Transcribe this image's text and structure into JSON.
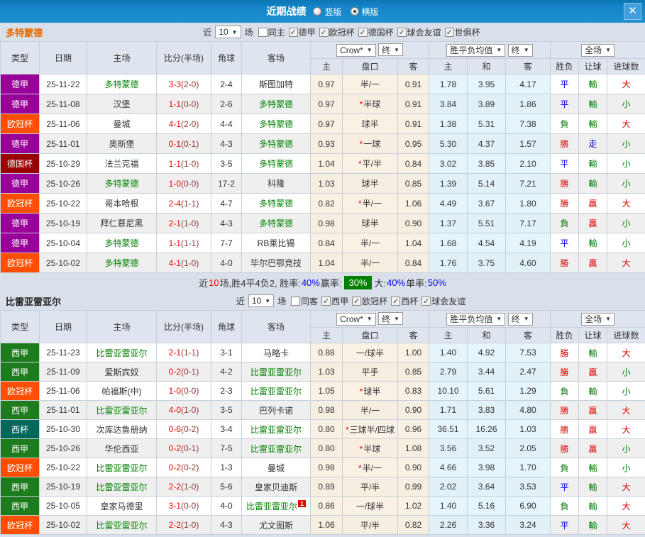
{
  "header": {
    "title": "近期战绩",
    "radios": [
      {
        "label": "竖版",
        "selected": false
      },
      {
        "label": "横版",
        "selected": true
      }
    ],
    "close_label": "✕"
  },
  "table_header": {
    "cols": [
      "类型",
      "日期",
      "主场",
      "比分(半场)",
      "角球",
      "客场"
    ],
    "odds_dropdown": "Crow*",
    "final_dropdown": "终",
    "mean_dropdown": "胜平负均值",
    "full_dropdown": "全场",
    "sub": [
      "主",
      "盘口",
      "客",
      "主",
      "和",
      "客",
      "胜负",
      "让球",
      "进球数"
    ]
  },
  "league_colors": {
    "德甲": "#990099",
    "欧冠杯": "#ff4e00",
    "德国杯": "#990000",
    "西甲": "#1e7c1e",
    "西杯": "#00695c"
  },
  "sections": [
    {
      "team": "多特蒙德",
      "team_color": "#e56a00",
      "filters": {
        "near": "近",
        "count": "10",
        "games": "场",
        "checkboxes": [
          {
            "label": "同主",
            "checked": false
          },
          {
            "label": "德甲",
            "checked": true
          },
          {
            "label": "欧冠杯",
            "checked": true
          },
          {
            "label": "德国杯",
            "checked": true
          },
          {
            "label": "球会友谊",
            "checked": true
          },
          {
            "label": "世俱杯",
            "checked": true
          }
        ]
      },
      "rows": [
        {
          "league": "德甲",
          "date": "25-11-22",
          "home": "多特蒙德",
          "ft": "3-3",
          "ht": "(2-0)",
          "corner": "2-4",
          "away": "斯图加特",
          "odds": [
            "0.97",
            "半/一",
            "0.91"
          ],
          "means": [
            "1.78",
            "3.95",
            "4.17"
          ],
          "results": [
            "平",
            "輸",
            "大"
          ]
        },
        {
          "league": "德甲",
          "date": "25-11-08",
          "home": "汉堡",
          "ft": "1-1",
          "ht": "(0-0)",
          "corner": "2-6",
          "away": "多特蒙德",
          "odds": [
            "0.97",
            "*半球",
            "0.91"
          ],
          "means": [
            "3.84",
            "3.89",
            "1.86"
          ],
          "results": [
            "平",
            "輸",
            "小"
          ]
        },
        {
          "league": "欧冠杯",
          "date": "25-11-06",
          "home": "曼城",
          "ft": "4-1",
          "ht": "(2-0)",
          "corner": "4-4",
          "away": "多特蒙德",
          "odds": [
            "0.97",
            "球半",
            "0.91"
          ],
          "means": [
            "1.38",
            "5.31",
            "7.38"
          ],
          "results": [
            "負",
            "輸",
            "大"
          ]
        },
        {
          "league": "德甲",
          "date": "25-11-01",
          "home": "奥斯堡",
          "ft": "0-1",
          "ht": "(0-1)",
          "corner": "4-3",
          "away": "多特蒙德",
          "odds": [
            "0.93",
            "*一球",
            "0.95"
          ],
          "means": [
            "5.30",
            "4.37",
            "1.57"
          ],
          "results": [
            "勝",
            "走",
            "小"
          ]
        },
        {
          "league": "德国杯",
          "date": "25-10-29",
          "home": "法兰克福",
          "ft": "1-1",
          "ht": "(1-0)",
          "corner": "3-5",
          "away": "多特蒙德",
          "odds": [
            "1.04",
            "*平/半",
            "0.84"
          ],
          "means": [
            "3.02",
            "3.85",
            "2.10"
          ],
          "results": [
            "平",
            "輸",
            "小"
          ]
        },
        {
          "league": "德甲",
          "date": "25-10-26",
          "home": "多特蒙德",
          "ft": "1-0",
          "ht": "(0-0)",
          "corner": "17-2",
          "away": "科隆",
          "odds": [
            "1.03",
            "球半",
            "0.85"
          ],
          "means": [
            "1.39",
            "5.14",
            "7.21"
          ],
          "results": [
            "勝",
            "輸",
            "小"
          ]
        },
        {
          "league": "欧冠杯",
          "date": "25-10-22",
          "home": "哥本哈根",
          "ft": "2-4",
          "ht": "(1-1)",
          "corner": "4-7",
          "away": "多特蒙德",
          "odds": [
            "0.82",
            "*半/一",
            "1.06"
          ],
          "means": [
            "4.49",
            "3.67",
            "1.80"
          ],
          "results": [
            "勝",
            "贏",
            "大"
          ]
        },
        {
          "league": "德甲",
          "date": "25-10-19",
          "home": "拜仁慕尼黑",
          "ft": "2-1",
          "ht": "(1-0)",
          "corner": "4-3",
          "away": "多特蒙德",
          "odds": [
            "0.98",
            "球半",
            "0.90"
          ],
          "means": [
            "1.37",
            "5.51",
            "7.17"
          ],
          "results": [
            "負",
            "贏",
            "小"
          ]
        },
        {
          "league": "德甲",
          "date": "25-10-04",
          "home": "多特蒙德",
          "ft": "1-1",
          "ht": "(1-1)",
          "corner": "7-7",
          "away": "RB莱比锡",
          "odds": [
            "0.84",
            "半/一",
            "1.04"
          ],
          "means": [
            "1.68",
            "4.54",
            "4.19"
          ],
          "results": [
            "平",
            "輸",
            "小"
          ]
        },
        {
          "league": "欧冠杯",
          "date": "25-10-02",
          "home": "多特蒙德",
          "ft": "4-1",
          "ht": "(1-0)",
          "corner": "4-0",
          "away": "毕尔巴鄂竞技",
          "odds": [
            "1.04",
            "半/一",
            "0.84"
          ],
          "means": [
            "1.76",
            "3.75",
            "4.60"
          ],
          "results": [
            "勝",
            "贏",
            "大"
          ]
        }
      ],
      "summary": [
        {
          "text": "近",
          "color": "black"
        },
        {
          "text": "10",
          "color": "red"
        },
        {
          "text": "场,胜4平4负2, 胜率:",
          "color": "black"
        },
        {
          "text": "40%",
          "color": "blue"
        },
        {
          "text": " 赢率: ",
          "color": "black"
        },
        {
          "text": "30%",
          "color": "greenbox"
        },
        {
          "text": " 大:",
          "color": "black"
        },
        {
          "text": "40%",
          "color": "blue"
        },
        {
          "text": " 单率:",
          "color": "black"
        },
        {
          "text": "50%",
          "color": "blue"
        }
      ]
    },
    {
      "team": "比雷亚雷亚尔",
      "team_color": "#222222",
      "filters": {
        "near": "近",
        "count": "10",
        "games": "场",
        "checkboxes": [
          {
            "label": "同客",
            "checked": false
          },
          {
            "label": "西甲",
            "checked": true
          },
          {
            "label": "欧冠杯",
            "checked": true
          },
          {
            "label": "西杯",
            "checked": true
          },
          {
            "label": "球会友谊",
            "checked": true
          }
        ]
      },
      "rows": [
        {
          "league": "西甲",
          "date": "25-11-23",
          "home": "比雷亚雷亚尔",
          "ft": "2-1",
          "ht": "(1-1)",
          "corner": "3-1",
          "away": "马略卡",
          "odds": [
            "0.88",
            "一/球半",
            "1.00"
          ],
          "means": [
            "1.40",
            "4.92",
            "7.53"
          ],
          "results": [
            "勝",
            "輸",
            "大"
          ]
        },
        {
          "league": "西甲",
          "date": "25-11-09",
          "home": "爱斯宾奴",
          "ft": "0-2",
          "ht": "(0-1)",
          "corner": "4-2",
          "away": "比雷亚雷亚尔",
          "odds": [
            "1.03",
            "平手",
            "0.85"
          ],
          "means": [
            "2.79",
            "3.44",
            "2.47"
          ],
          "results": [
            "勝",
            "贏",
            "小"
          ]
        },
        {
          "league": "欧冠杯",
          "date": "25-11-06",
          "home": "帕福斯(中)",
          "ft": "1-0",
          "ht": "(0-0)",
          "corner": "2-3",
          "away": "比雷亚雷亚尔",
          "odds": [
            "1.05",
            "*球半",
            "0.83"
          ],
          "means": [
            "10.10",
            "5.61",
            "1.29"
          ],
          "results": [
            "負",
            "輸",
            "小"
          ]
        },
        {
          "league": "西甲",
          "date": "25-11-01",
          "home": "比雷亚雷亚尔",
          "ft": "4-0",
          "ht": "(1-0)",
          "corner": "3-5",
          "away": "巴列卡诺",
          "odds": [
            "0.98",
            "半/一",
            "0.90"
          ],
          "means": [
            "1.71",
            "3.83",
            "4.80"
          ],
          "results": [
            "勝",
            "贏",
            "大"
          ]
        },
        {
          "league": "西杯",
          "date": "25-10-30",
          "home": "次库达鲁册纳",
          "ft": "0-6",
          "ht": "(0-2)",
          "corner": "3-4",
          "away": "比雷亚雷亚尔",
          "odds": [
            "0.80",
            "*三球半/四球",
            "0.96"
          ],
          "means": [
            "36.51",
            "16.26",
            "1.03"
          ],
          "results": [
            "勝",
            "贏",
            "大"
          ]
        },
        {
          "league": "西甲",
          "date": "25-10-26",
          "home": "华伦西亚",
          "ft": "0-2",
          "ht": "(0-1)",
          "corner": "7-5",
          "away": "比雷亚雷亚尔",
          "odds": [
            "0.80",
            "*半球",
            "1.08"
          ],
          "means": [
            "3.56",
            "3.52",
            "2.05"
          ],
          "results": [
            "勝",
            "贏",
            "小"
          ]
        },
        {
          "league": "欧冠杯",
          "date": "25-10-22",
          "home": "比雷亚雷亚尔",
          "ft": "0-2",
          "ht": "(0-2)",
          "corner": "1-3",
          "away": "曼城",
          "odds": [
            "0.98",
            "*半/一",
            "0.90"
          ],
          "means": [
            "4.66",
            "3.98",
            "1.70"
          ],
          "results": [
            "負",
            "輸",
            "小"
          ]
        },
        {
          "league": "西甲",
          "date": "25-10-19",
          "home": "比雷亚雷亚尔",
          "ft": "2-2",
          "ht": "(1-0)",
          "corner": "5-6",
          "away": "皇家贝迪斯",
          "odds": [
            "0.89",
            "平/半",
            "0.99"
          ],
          "means": [
            "2.02",
            "3.64",
            "3.53"
          ],
          "results": [
            "平",
            "輸",
            "大"
          ]
        },
        {
          "league": "西甲",
          "date": "25-10-05",
          "home": "皇家马德里",
          "ft": "3-1",
          "ht": "(0-0)",
          "corner": "4-0",
          "away": "比雷亚雷亚尔",
          "away_sup": "1",
          "odds": [
            "0.86",
            "一/球半",
            "1.02"
          ],
          "means": [
            "1.40",
            "5.16",
            "6.90"
          ],
          "results": [
            "負",
            "輸",
            "大"
          ]
        },
        {
          "league": "欧冠杯",
          "date": "25-10-02",
          "home": "比雷亚雷亚尔",
          "ft": "2-2",
          "ht": "(1-0)",
          "corner": "4-3",
          "away": "尤文图斯",
          "odds": [
            "1.06",
            "平/半",
            "0.82"
          ],
          "means": [
            "2.26",
            "3.36",
            "3.24"
          ],
          "results": [
            "平",
            "輸",
            "大"
          ]
        }
      ]
    }
  ]
}
